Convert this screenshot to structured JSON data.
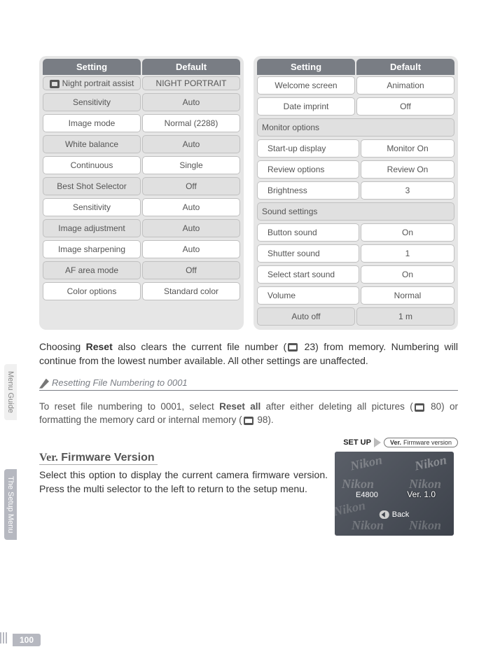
{
  "left_table": {
    "headers": [
      "Setting",
      "Default"
    ],
    "rows": [
      {
        "setting": "Night portrait assist",
        "default": "NIGHT PORTRAIT",
        "icon": true,
        "shade": "grey",
        "tall": true
      },
      {
        "setting": "Sensitivity",
        "default": "Auto",
        "shade": "grey"
      },
      {
        "setting": "Image mode",
        "default": "Normal (2288)",
        "shade": "white"
      },
      {
        "setting": "White balance",
        "default": "Auto",
        "shade": "grey"
      },
      {
        "setting": "Continuous",
        "default": "Single",
        "shade": "white"
      },
      {
        "setting": "Best Shot Selector",
        "default": "Off",
        "shade": "grey"
      },
      {
        "setting": "Sensitivity",
        "default": "Auto",
        "shade": "white"
      },
      {
        "setting": "Image adjustment",
        "default": "Auto",
        "shade": "grey"
      },
      {
        "setting": "Image sharpening",
        "default": "Auto",
        "shade": "white"
      },
      {
        "setting": "AF area mode",
        "default": "Off",
        "shade": "grey"
      },
      {
        "setting": "Color options",
        "default": "Standard color",
        "shade": "white"
      }
    ]
  },
  "right_table": {
    "headers": [
      "Setting",
      "Default"
    ],
    "rows": [
      {
        "setting": "Welcome screen",
        "default": "Animation",
        "shade": "white"
      },
      {
        "setting": "Date imprint",
        "default": "Off",
        "shade": "white"
      },
      {
        "section": "Monitor options"
      },
      {
        "setting": "Start-up display",
        "default": "Monitor On",
        "shade": "white",
        "indent": true
      },
      {
        "setting": "Review options",
        "default": "Review On",
        "shade": "white",
        "indent": true
      },
      {
        "setting": "Brightness",
        "default": "3",
        "shade": "white",
        "indent": true
      },
      {
        "section": "Sound settings"
      },
      {
        "setting": "Button sound",
        "default": "On",
        "shade": "white",
        "indent": true
      },
      {
        "setting": "Shutter sound",
        "default": "1",
        "shade": "white",
        "indent": true
      },
      {
        "setting": "Select start sound",
        "default": "On",
        "shade": "white",
        "indent": true
      },
      {
        "setting": "Volume",
        "default": "Normal",
        "shade": "white",
        "indent": true
      },
      {
        "setting": "Auto off",
        "default": "1 m",
        "shade": "grey"
      }
    ]
  },
  "para1_a": "Choosing ",
  "para1_b": "Reset",
  "para1_c": " also clears the current file number (",
  "para1_d": " 23) from memory. Numbering will continue from the lowest number available.  All other settings are unaffected.",
  "note_title": "Resetting File Numbering to 0001",
  "note_a": "To reset file numbering to 0001, select ",
  "note_b": "Reset all",
  "note_c": " after either deleting all pictures  (",
  "note_d": " 80) or formatting the memory card or internal memory (",
  "note_e": " 98).",
  "fw_heading_prefix": "Ver.",
  "fw_heading": "Firmware Version",
  "fw_text": "Select this option to display the current camera firmware version.  Press the multi selector to the left to return to the setup menu.",
  "crumb_setup": "SET UP",
  "crumb_ver_prefix": "Ver.",
  "crumb_ver_label": "Firmware version",
  "screen_brand": "Nikon",
  "screen_model": "E4800",
  "screen_version": "Ver. 1.0",
  "screen_back": "Back",
  "side_tab_1": "Menu Guide",
  "side_tab_2": "The Setup Menu",
  "page_number": "100"
}
